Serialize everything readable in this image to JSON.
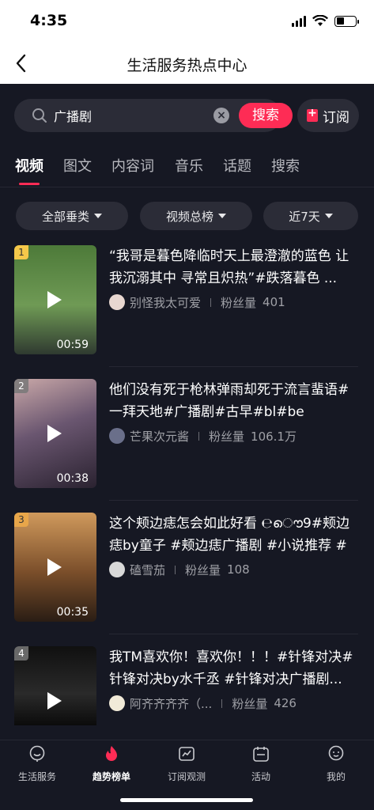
{
  "status_bar": {
    "time": "4:35"
  },
  "nav": {
    "title": "生活服务热点中心"
  },
  "search": {
    "value": "广播剧",
    "button_label": "搜索"
  },
  "subscribe": {
    "label": "订阅"
  },
  "tabs": [
    {
      "label": "视频",
      "active": true
    },
    {
      "label": "图文"
    },
    {
      "label": "内容词"
    },
    {
      "label": "音乐"
    },
    {
      "label": "话题"
    },
    {
      "label": "搜索"
    }
  ],
  "filters": [
    {
      "label": "全部垂类"
    },
    {
      "label": "视频总榜"
    },
    {
      "label": "近7天"
    }
  ],
  "items": [
    {
      "rank": "1",
      "duration": "00:59",
      "title": "“我哥是暮色降临时天上最澄澈的蓝色 让我沉溺其中 寻常且炽热”#跌落暮色 ...",
      "author": "别怪我太可爱",
      "fans_label": "粉丝量",
      "fans": "401",
      "thumb_colors": [
        "#4d7a39",
        "#8bb070"
      ]
    },
    {
      "rank": "2",
      "duration": "00:38",
      "title": "他们没有死于枪林弹雨却死于流言蜚语#一拜天地#广播剧#古早#bl#be",
      "author": "芒果次元酱",
      "fans_label": "粉丝量",
      "fans": "106.1万",
      "thumb_colors": [
        "#6a5670",
        "#c9a8a8"
      ]
    },
    {
      "rank": "3",
      "duration": "00:35",
      "title": "这个颊边痣怎会如此好看 ℮ൌ9#颊边痣by童子 #颊边痣广播剧 #小说推荐 #民...",
      "author": "磕雪茄",
      "fans_label": "粉丝量",
      "fans": "108",
      "thumb_colors": [
        "#7a4e2a",
        "#d09a5c"
      ]
    },
    {
      "rank": "4",
      "duration": "",
      "title": "我TM喜欢你！喜欢你！！！#针锋对决#针锋对决by水千丞 #针锋对决广播剧...",
      "author": "阿齐齐齐齐（...",
      "fans_label": "粉丝量",
      "fans": "426",
      "thumb_colors": [
        "#101010",
        "#3a3a3a"
      ]
    }
  ],
  "bottom_nav": [
    {
      "label": "生活服务",
      "icon": "face-smile-icon"
    },
    {
      "label": "趋势榜单",
      "icon": "flame-icon",
      "active": true
    },
    {
      "label": "订阅观测",
      "icon": "chart-line-icon"
    },
    {
      "label": "活动",
      "icon": "calendar-icon"
    },
    {
      "label": "我的",
      "icon": "profile-icon"
    }
  ],
  "colors": {
    "accent": "#fe2c55",
    "background": "#161823",
    "surface": "#2b2c37"
  }
}
